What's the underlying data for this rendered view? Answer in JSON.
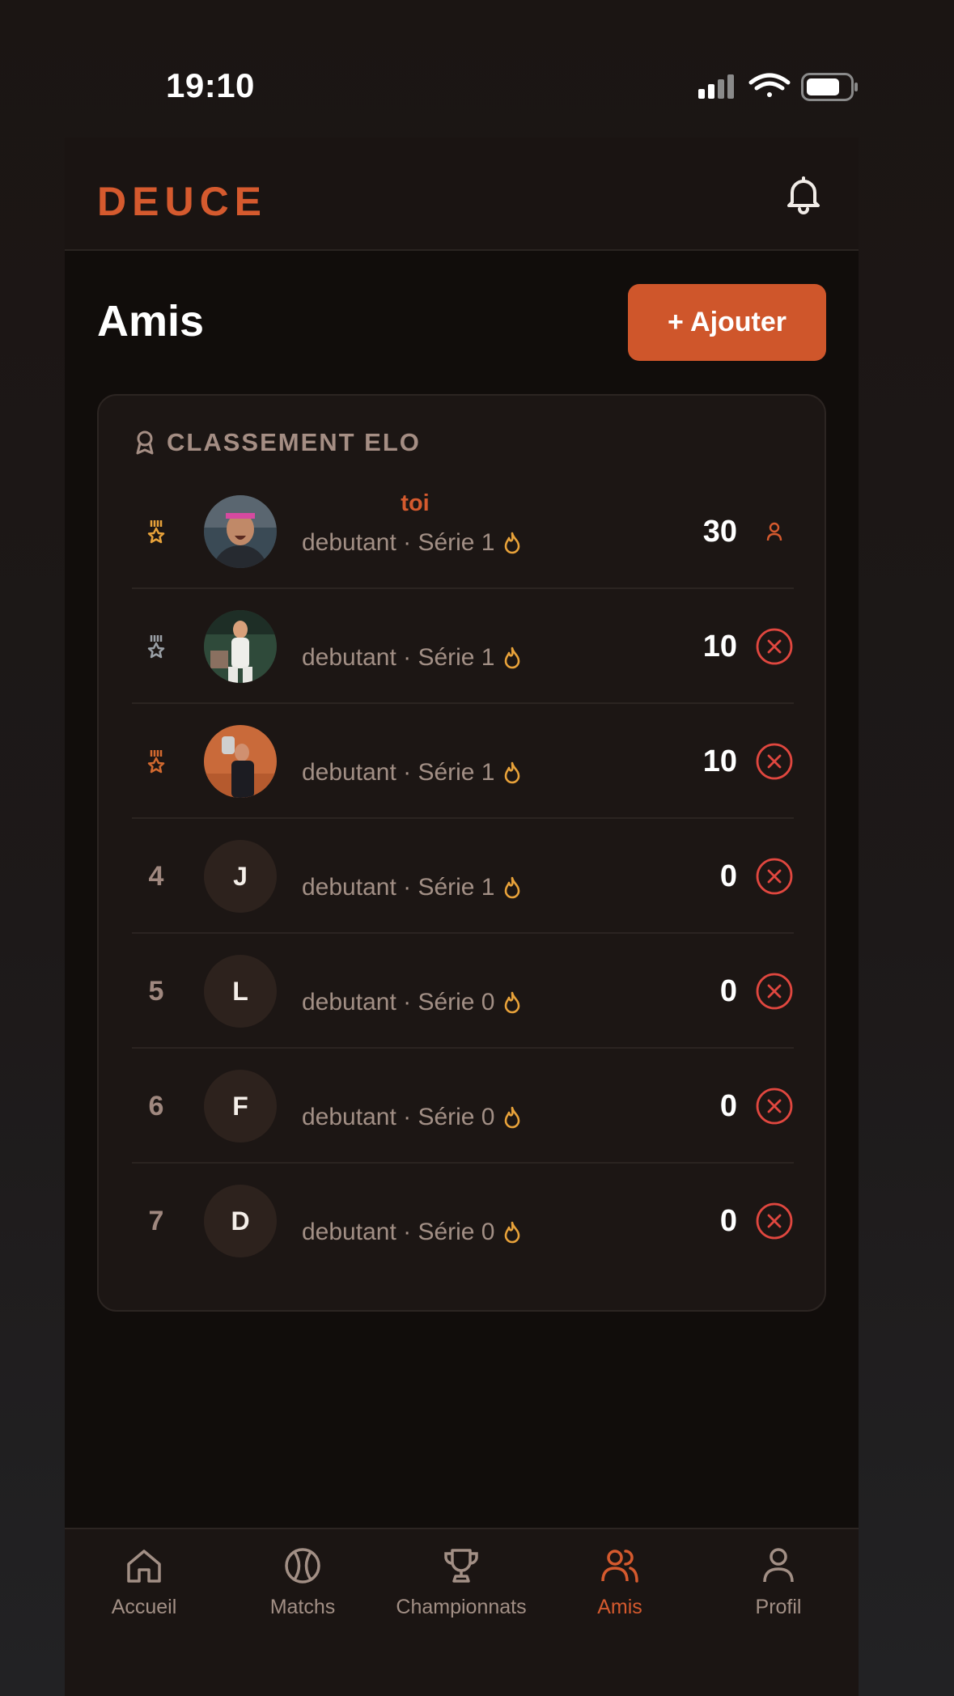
{
  "status_bar": {
    "time": "19:10"
  },
  "header": {
    "logo": "DEUCE"
  },
  "page": {
    "title": "Amis",
    "add_label": "+ Ajouter"
  },
  "leaderboard": {
    "title": "CLASSEMENT ELO",
    "rows": [
      {
        "rank": "",
        "medal": "gold",
        "avatar_letter": "",
        "name": "toi",
        "subtitle": "debutant · Série 1",
        "score": "30",
        "action": "profile"
      },
      {
        "rank": "",
        "medal": "silver",
        "avatar_letter": "",
        "name": "",
        "subtitle": "debutant · Série 1",
        "score": "10",
        "action": "remove"
      },
      {
        "rank": "",
        "medal": "bronze",
        "avatar_letter": "",
        "name": "",
        "subtitle": "debutant · Série 1",
        "score": "10",
        "action": "remove"
      },
      {
        "rank": "4",
        "medal": "",
        "avatar_letter": "J",
        "name": "",
        "subtitle": "debutant · Série 1",
        "score": "0",
        "action": "remove"
      },
      {
        "rank": "5",
        "medal": "",
        "avatar_letter": "L",
        "name": "",
        "subtitle": "debutant · Série 0",
        "score": "0",
        "action": "remove"
      },
      {
        "rank": "6",
        "medal": "",
        "avatar_letter": "F",
        "name": "",
        "subtitle": "debutant · Série 0",
        "score": "0",
        "action": "remove"
      },
      {
        "rank": "7",
        "medal": "",
        "avatar_letter": "D",
        "name": "",
        "subtitle": "debutant · Série 0",
        "score": "0",
        "action": "remove"
      }
    ]
  },
  "tabs": [
    {
      "label": "Accueil",
      "icon": "home-icon"
    },
    {
      "label": "Matchs",
      "icon": "tennis-ball-icon"
    },
    {
      "label": "Championnats",
      "icon": "trophy-icon"
    },
    {
      "label": "Amis",
      "icon": "users-icon",
      "active": true
    },
    {
      "label": "Profil",
      "icon": "user-icon"
    }
  ],
  "colors": {
    "accent": "#d55a2e",
    "background": "#110d0b",
    "card": "#1c1614",
    "muted": "#a28f85",
    "flame": "#e8a23a",
    "remove": "#e0473f"
  }
}
